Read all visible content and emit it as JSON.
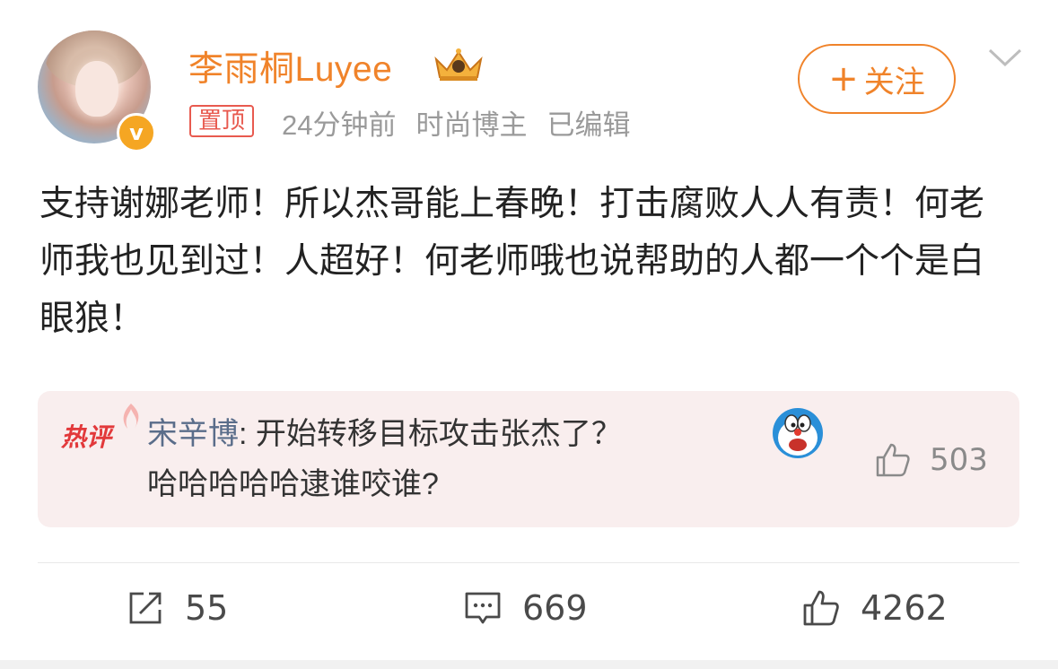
{
  "post": {
    "username": "李雨桐Luyee",
    "pinned_label": "置顶",
    "time_ago": "24分钟前",
    "category": "时尚博主",
    "edited_label": "已编辑",
    "follow_label": "关注",
    "content": "支持谢娜老师！所以杰哥能上春晚！打击腐败人人有责！何老师我也见到过！人超好！何老师哦也说帮助的人都一个个是白眼狼！"
  },
  "hot_comment": {
    "badge": "热评",
    "user": "宋辛博",
    "separator": ": ",
    "text_line1": "开始转移目标攻击张杰了？",
    "text_line2": "哈哈哈哈哈逮谁咬谁?",
    "likes": "503"
  },
  "actions": {
    "reposts": "55",
    "comments": "669",
    "likes": "4262"
  },
  "colors": {
    "accent": "#f0832a",
    "pinned": "#e85a4f",
    "hot_bg": "#f9eeee",
    "comment_user": "#5a6d8a"
  },
  "icons": [
    "verified-badge-icon",
    "crown-icon",
    "chevron-down-icon",
    "flame-icon",
    "doraemon-emoji-icon",
    "thumbs-up-icon",
    "repost-icon",
    "comment-icon"
  ]
}
